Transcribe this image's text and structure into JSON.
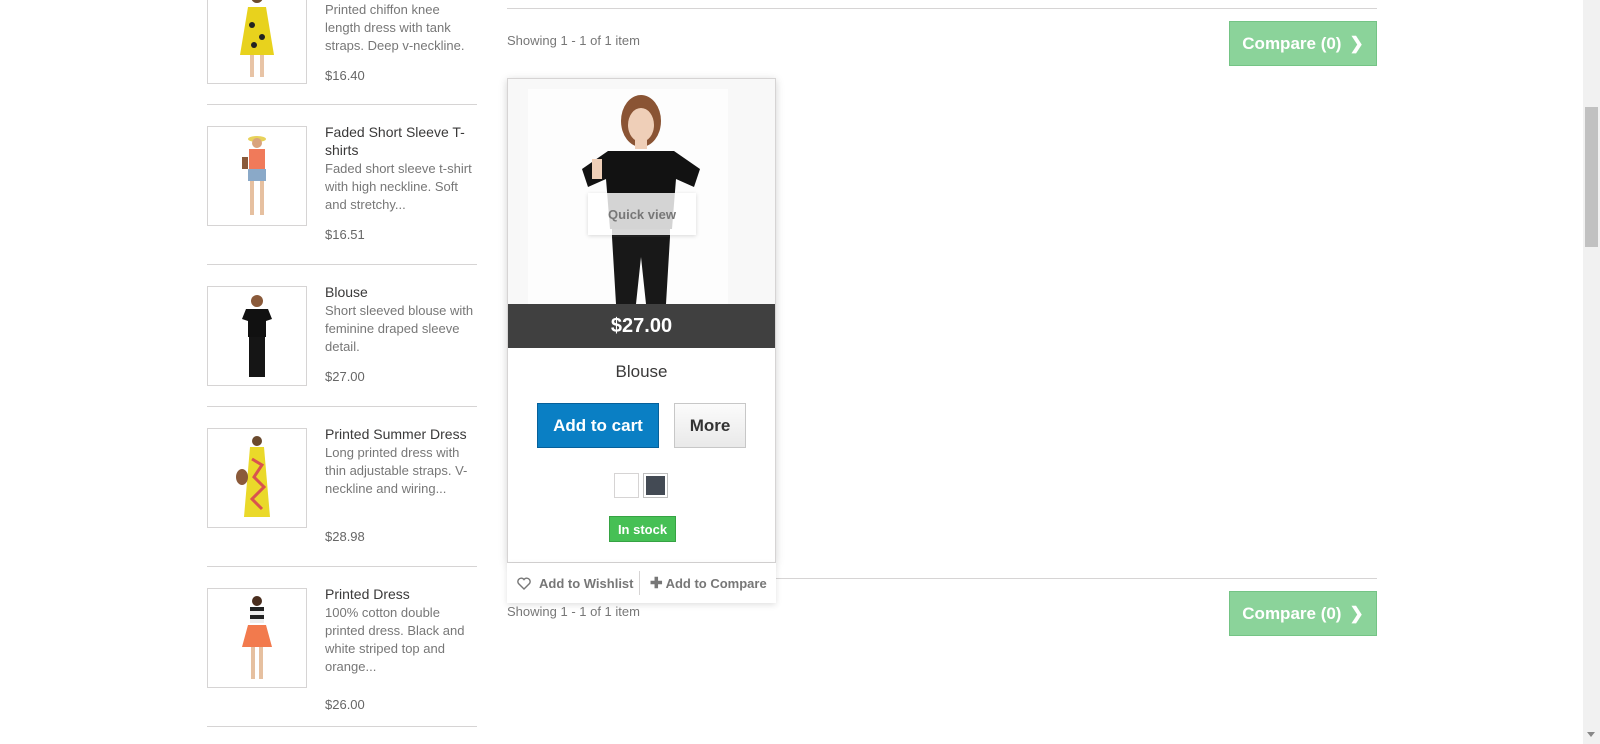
{
  "sidebar": {
    "items": [
      {
        "name": "",
        "desc": "Printed chiffon knee length dress with tank straps. Deep v-neckline.",
        "price": "$16.40"
      },
      {
        "name": "Faded Short Sleeve T-shirts",
        "desc": "Faded short sleeve t-shirt with high neckline. Soft and stretchy...",
        "price": "$16.51"
      },
      {
        "name": "Blouse",
        "desc": "Short sleeved blouse with feminine draped sleeve detail.",
        "price": "$27.00"
      },
      {
        "name": "Printed Summer Dress",
        "desc": "Long printed dress with thin adjustable straps. V-neckline and wiring...",
        "price": "$28.98"
      },
      {
        "name": "Printed Dress",
        "desc": "100% cotton double printed dress. Black and white striped top and orange...",
        "price": "$26.00"
      }
    ]
  },
  "listing": {
    "showing_top": "Showing 1 - 1 of 1 item",
    "showing_bottom": "Showing 1 - 1 of 1 item",
    "compare_label": "Compare (0)"
  },
  "product": {
    "name": "Blouse",
    "price": "$27.00",
    "quick_view": "Quick view",
    "add_to_cart": "Add to cart",
    "more": "More",
    "stock": "In stock",
    "wishlist": "Add to Wishlist",
    "add_compare": "Add to Compare",
    "colors": [
      "#ffffff",
      "#434a54"
    ]
  },
  "colors": {
    "compare_bg": "#8bd39a",
    "cart_bg": "#0a7fc4",
    "stock_bg": "#46c055",
    "price_bar": "#404040"
  }
}
